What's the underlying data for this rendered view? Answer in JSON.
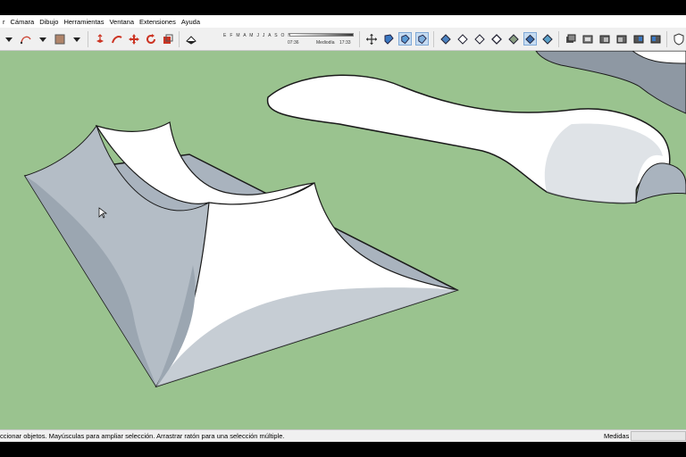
{
  "menu": {
    "items": [
      {
        "label": "r"
      },
      {
        "label": "Cámara"
      },
      {
        "label": "Dibujo"
      },
      {
        "label": "Herramientas"
      },
      {
        "label": "Ventana"
      },
      {
        "label": "Extensiones"
      },
      {
        "label": "Ayuda"
      }
    ]
  },
  "toolbar": {
    "shadow_months": "E F M A M J J A S O N D",
    "time_start": "07:36",
    "time_mid": "Mediodía",
    "time_end": "17:33"
  },
  "status": {
    "hint": "ccionar objetos. Mayúsculas para ampliar selección. Arrastrar ratón para una selección múltiple.",
    "measure_label": "Medidas",
    "measure_value": ""
  },
  "colors": {
    "background": "#9ac38f",
    "face_front": "#ffffff",
    "face_back": "#a9b3be",
    "edge": "#1a1a1a"
  }
}
